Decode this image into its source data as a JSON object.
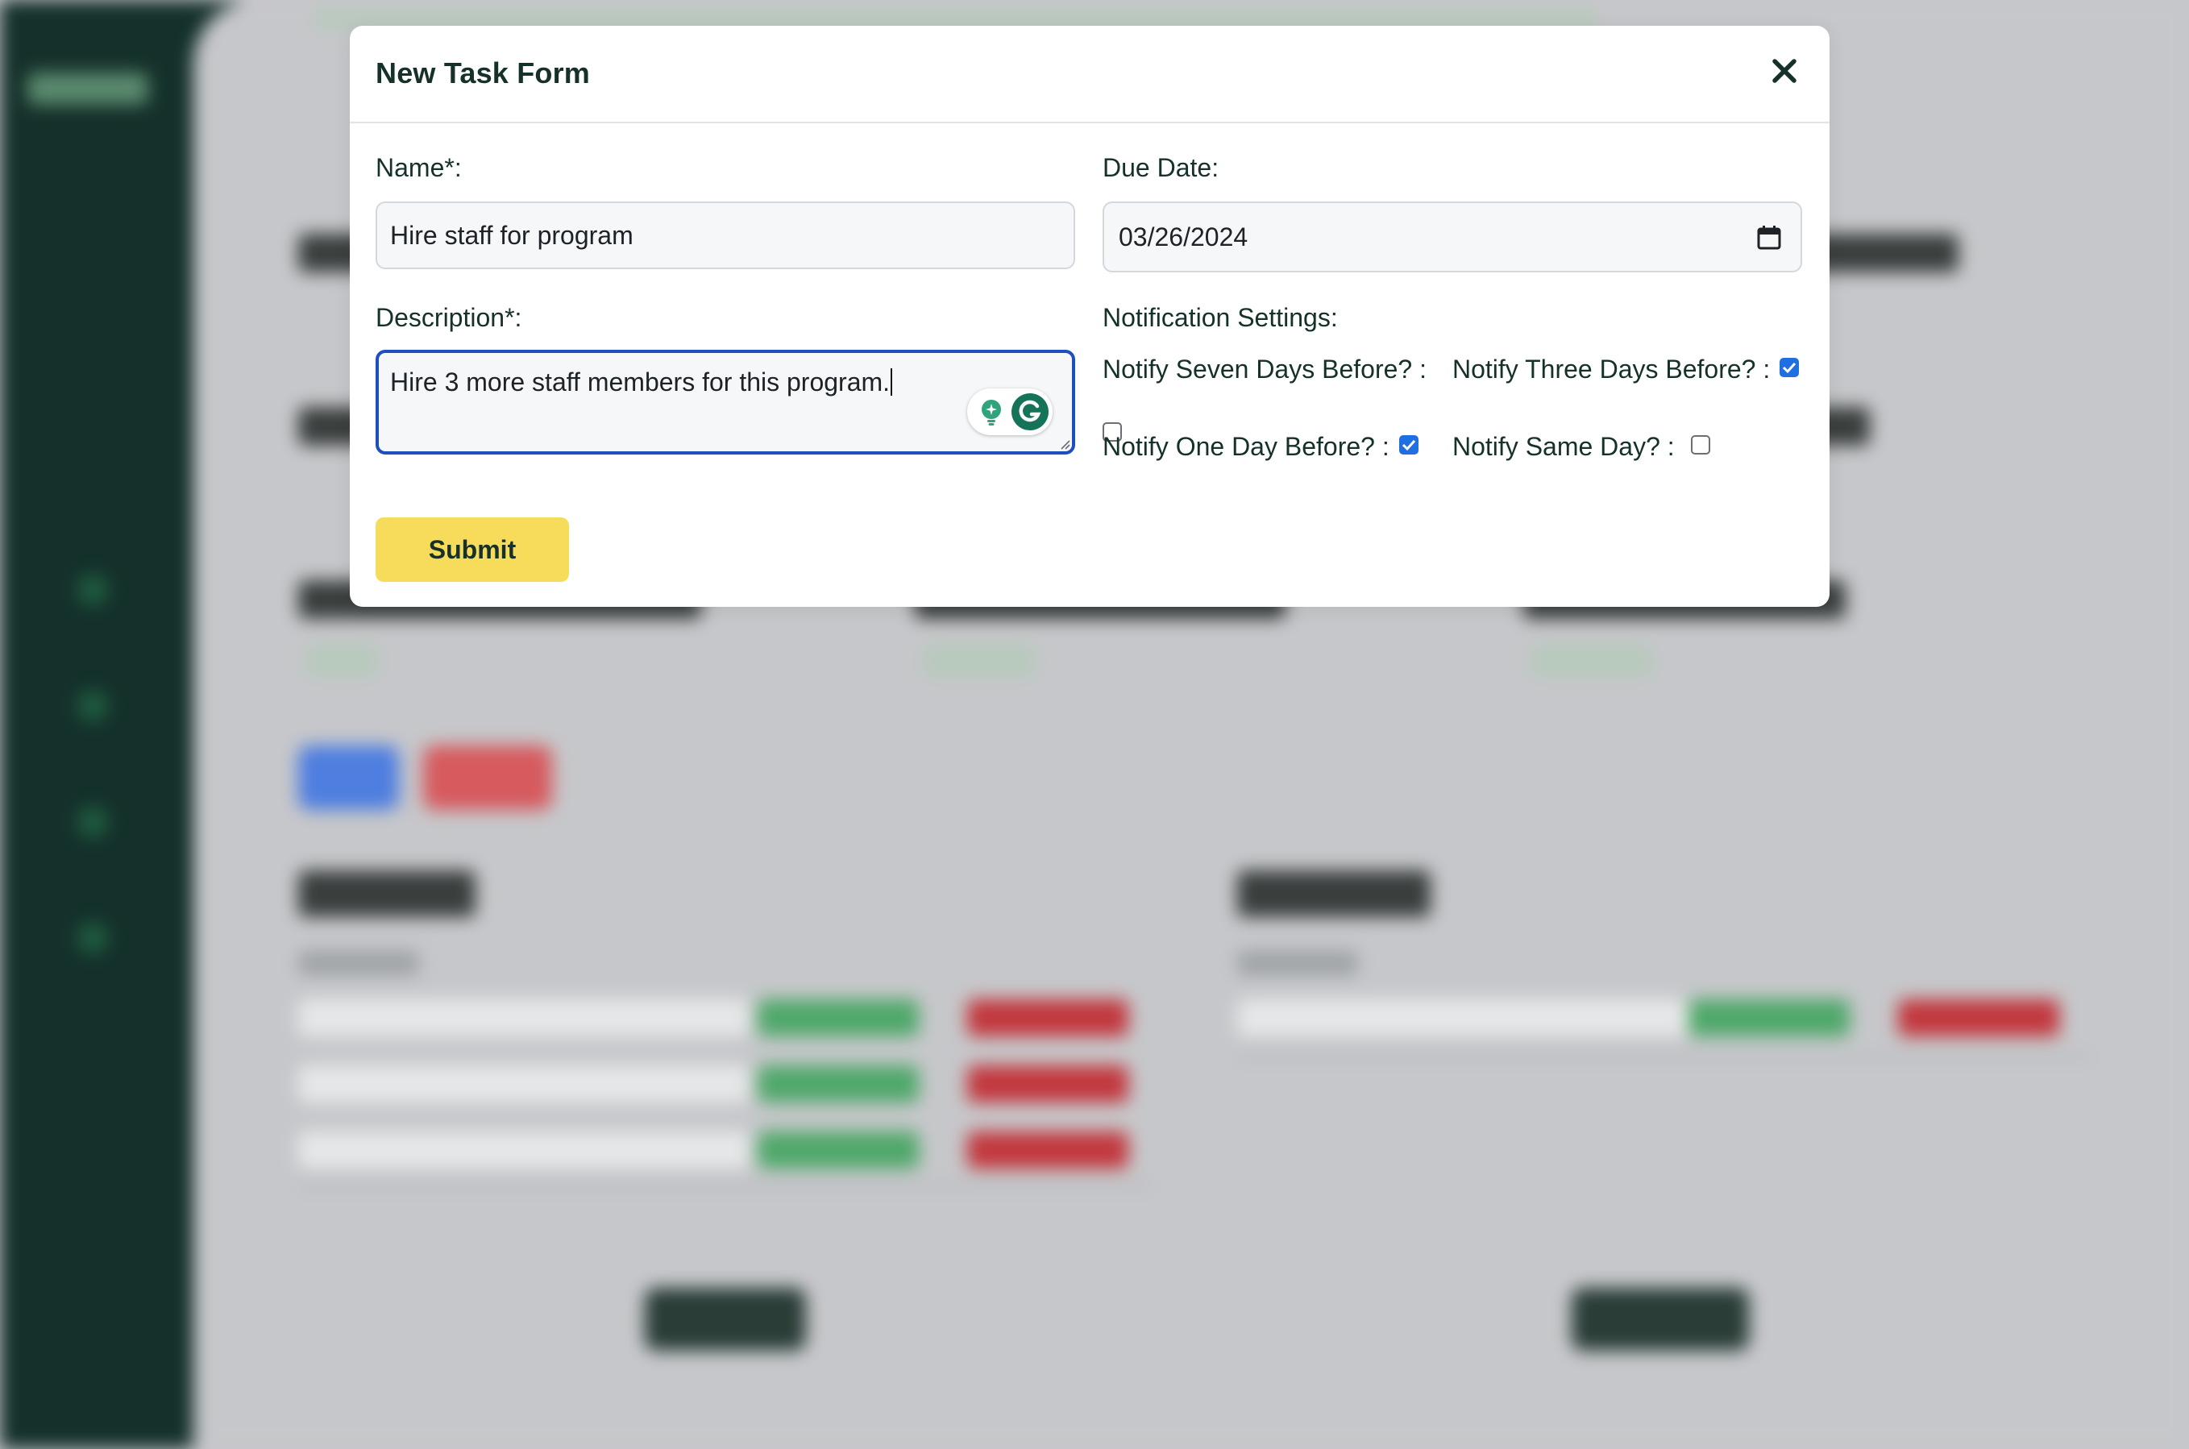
{
  "modal": {
    "title": "New Task Form",
    "close_icon": "close-icon",
    "submit_label": "Submit"
  },
  "form": {
    "name_label": "Name*:",
    "name_value": "Hire staff for program",
    "due_date_label": "Due Date:",
    "due_date_value": "03/26/2024",
    "description_label": "Description*:",
    "description_value": "Hire 3 more staff members for this program.",
    "notification_label": "Notification Settings:",
    "notify_seven_label": "Notify Seven Days Before? :",
    "notify_seven_checked": false,
    "notify_three_label": "Notify Three Days Before? :",
    "notify_three_checked": true,
    "notify_one_label": "Notify One Day Before? :",
    "notify_one_checked": true,
    "notify_same_label": "Notify Same Day? :",
    "notify_same_checked": false
  },
  "colors": {
    "accent_yellow": "#f7dc5b",
    "focus_blue": "#1d4fbf",
    "checkbox_blue": "#1f6fe0",
    "dark_green": "#16302a",
    "sidebar": "#14302a"
  }
}
